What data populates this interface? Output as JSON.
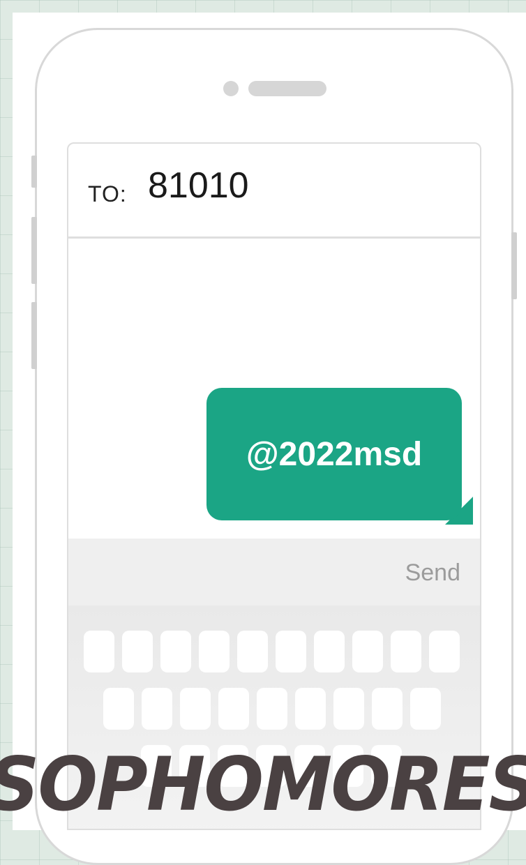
{
  "message": {
    "to_label": "TO:",
    "to_number": "81010",
    "bubble_text": "@2022msd",
    "send_label": "Send"
  },
  "caption": "SOPHOMORES",
  "colors": {
    "bubble": "#1ba585",
    "caption": "#4a4142",
    "background": "#dfeae3"
  },
  "icons": {
    "camera": "camera-icon",
    "speaker": "speaker-icon"
  }
}
